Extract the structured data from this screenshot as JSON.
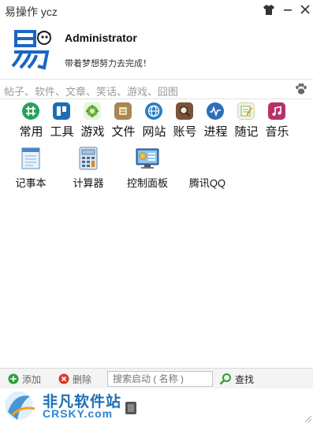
{
  "window": {
    "title": "易操作 ycz"
  },
  "profile": {
    "username": "Administrator",
    "motto": "带着梦想努力去完成！"
  },
  "search": {
    "placeholder": "帖子、软件、文章、笑话、游戏、囧图"
  },
  "categories": [
    {
      "label": "常用",
      "icon": "common-icon",
      "color": "#29a35a"
    },
    {
      "label": "工具",
      "icon": "tools-icon",
      "color": "#1f6db5"
    },
    {
      "label": "游戏",
      "icon": "games-icon",
      "color": "#5eaa2f"
    },
    {
      "label": "文件",
      "icon": "file-icon",
      "color": "#b08a52"
    },
    {
      "label": "网站",
      "icon": "website-icon",
      "color": "#2a7fc4"
    },
    {
      "label": "账号",
      "icon": "account-icon",
      "color": "#8a6040"
    },
    {
      "label": "进程",
      "icon": "process-icon",
      "color": "#2d6fb8"
    },
    {
      "label": "随记",
      "icon": "notes-icon",
      "color": "#86b34a"
    },
    {
      "label": "音乐",
      "icon": "music-icon",
      "color": "#b8306a"
    }
  ],
  "apps": [
    {
      "label": "记事本",
      "icon": "notepad-icon"
    },
    {
      "label": "计算器",
      "icon": "calculator-icon"
    },
    {
      "label": "控制面板",
      "icon": "control-panel-icon"
    },
    {
      "label": "腾讯QQ",
      "icon": "qq-icon"
    }
  ],
  "bottombar": {
    "add_label": "添加",
    "delete_label": "删除",
    "search_placeholder": "搜索启动 ( 名称 )",
    "find_label": "查找"
  },
  "watermark": {
    "text": "非凡软件站",
    "sub": "CRSKY.com"
  }
}
